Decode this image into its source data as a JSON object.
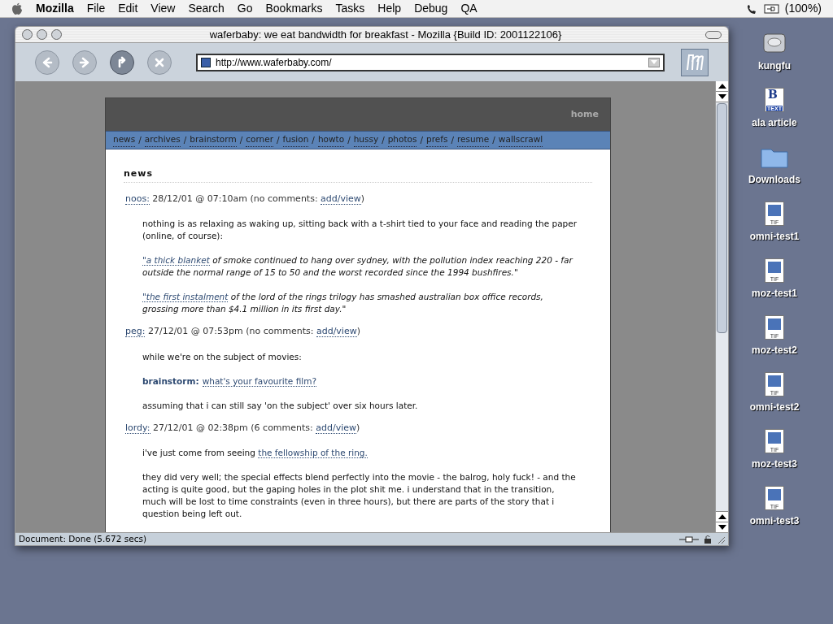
{
  "menubar": {
    "app": "Mozilla",
    "menus": [
      "File",
      "Edit",
      "View",
      "Search",
      "Go",
      "Bookmarks",
      "Tasks",
      "Help",
      "Debug",
      "QA"
    ],
    "battery": "(100%)"
  },
  "window": {
    "title": "waferbaby: we eat bandwidth for breakfast - Mozilla {Build ID: 2001122106}",
    "url": "http://www.waferbaby.com/",
    "status": "Document: Done (5.672 secs)"
  },
  "toolbar": [
    {
      "kind": "back",
      "disabled": true
    },
    {
      "kind": "forward",
      "disabled": true
    },
    {
      "kind": "reload",
      "disabled": false
    },
    {
      "kind": "stop",
      "disabled": true
    }
  ],
  "page": {
    "home": "home",
    "nav": [
      {
        "label": "news"
      },
      {
        "sep": "/",
        "label": "archives"
      },
      {
        "sep": "/",
        "label": "brainstorm"
      },
      {
        "sep": "/",
        "label": "corner"
      },
      {
        "sep": "/",
        "label": "fusion"
      },
      {
        "sep": "/",
        "label": "howto"
      },
      {
        "sep": "/",
        "label": "hussy"
      },
      {
        "sep": "/",
        "label": "photos"
      },
      {
        "sep": "/",
        "label": "prefs"
      },
      {
        "sep": "/",
        "label": "resume"
      },
      {
        "sep": "/",
        "label": "wallscrawl"
      }
    ],
    "heading": "news",
    "posts": [
      {
        "meta": [
          {
            "kind": "link",
            "text": "noos:"
          },
          {
            "kind": "text",
            "text": " 28/12/01 @ 07:10am (no comments: "
          },
          {
            "kind": "link",
            "text": "add/view"
          },
          {
            "kind": "text",
            "text": ")"
          }
        ],
        "paragraphs": [
          {
            "kind": "plain",
            "parts": [
              {
                "kind": "text",
                "text": "nothing is as relaxing as waking up, sitting back with a t-shirt tied to your face and reading the paper (online, of course):"
              }
            ]
          },
          {
            "kind": "quote",
            "parts": [
              {
                "kind": "link",
                "text": "\"a thick blanket"
              },
              {
                "kind": "text",
                "text": " of smoke continued to hang over sydney, with the pollution index reaching 220 - far outside the normal range of 15 to 50 and the worst recorded since the 1994 bushfires.\""
              }
            ]
          },
          {
            "kind": "quote",
            "parts": [
              {
                "kind": "link",
                "text": "\"the first instalment"
              },
              {
                "kind": "text",
                "text": " of the lord of the rings trilogy has smashed australian box office records, grossing more than $4.1 million in its first day.\""
              }
            ]
          }
        ]
      },
      {
        "meta": [
          {
            "kind": "link",
            "text": "peg:"
          },
          {
            "kind": "text",
            "text": " 27/12/01 @ 07:53pm (no comments: "
          },
          {
            "kind": "link",
            "text": "add/view"
          },
          {
            "kind": "text",
            "text": ")"
          }
        ],
        "paragraphs": [
          {
            "kind": "plain",
            "parts": [
              {
                "kind": "text",
                "text": "while we're on the subject of movies:"
              }
            ]
          },
          {
            "kind": "plain",
            "parts": [
              {
                "kind": "label",
                "text": "brainstorm:"
              },
              {
                "kind": "link",
                "text": "what's your favourite film?"
              }
            ]
          },
          {
            "kind": "plain",
            "parts": [
              {
                "kind": "text",
                "text": "assuming that i can still say 'on the subject' over six hours later."
              }
            ]
          }
        ]
      },
      {
        "meta": [
          {
            "kind": "link",
            "text": "lordy:"
          },
          {
            "kind": "text",
            "text": " 27/12/01 @ 02:38pm (6 comments: "
          },
          {
            "kind": "link",
            "text": "add/view"
          },
          {
            "kind": "text",
            "text": ")"
          }
        ],
        "paragraphs": [
          {
            "kind": "plain",
            "parts": [
              {
                "kind": "text",
                "text": "i've just come from seeing "
              },
              {
                "kind": "link",
                "text": "the fellowship of the ring."
              }
            ]
          },
          {
            "kind": "plain",
            "parts": [
              {
                "kind": "text",
                "text": "they did very well; the special effects blend perfectly into the movie - the balrog, holy fuck! - and the acting is quite good, but the gaping holes in the plot shit me. i understand that in the transition, much will be lost to time constraints (even in three hours), but there are parts of the story that i question being left out."
              }
            ]
          }
        ]
      }
    ]
  },
  "desktop": [
    {
      "kind": "drive",
      "name": "kungfu"
    },
    {
      "kind": "text",
      "name": "ala article",
      "badge": "TEXT",
      "letter": "B"
    },
    {
      "kind": "folder",
      "name": "Downloads"
    },
    {
      "kind": "tif",
      "name": "omni-test1",
      "badge": "TIF"
    },
    {
      "kind": "tif",
      "name": "moz-test1",
      "badge": "TIF"
    },
    {
      "kind": "tif",
      "name": "moz-test2",
      "badge": "TIF"
    },
    {
      "kind": "tif",
      "name": "omni-test2",
      "badge": "TIF"
    },
    {
      "kind": "tif",
      "name": "moz-test3",
      "badge": "TIF"
    },
    {
      "kind": "tif",
      "name": "omni-test3",
      "badge": "TIF"
    }
  ]
}
